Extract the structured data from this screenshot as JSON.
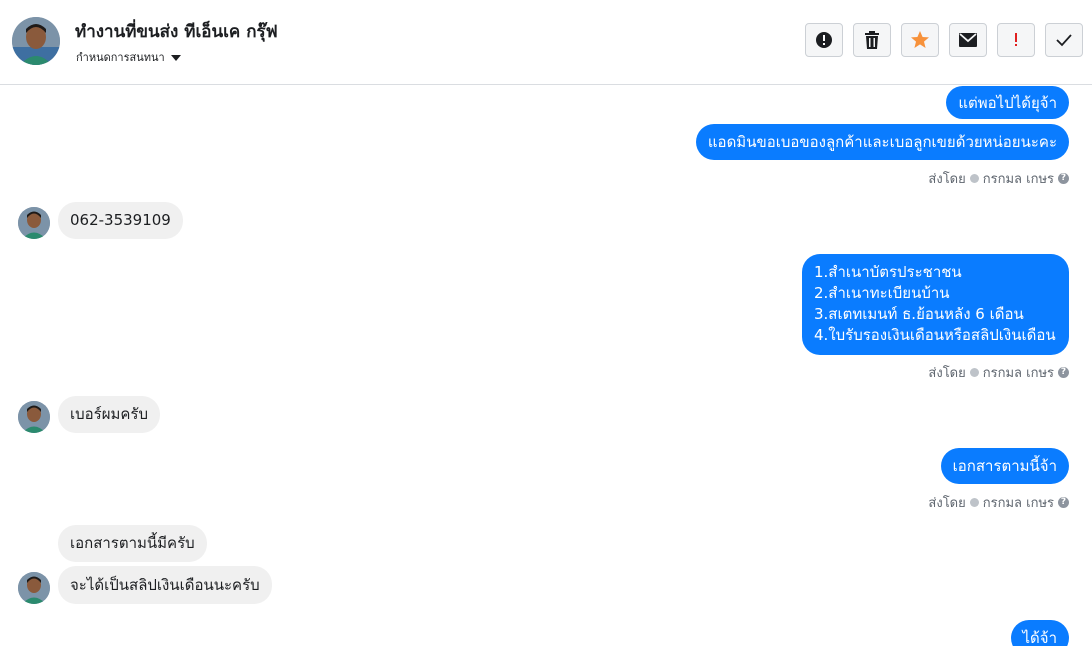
{
  "header": {
    "contact_name": "ทำงานที่ขนส่ง ทีเอ็นเค กรุ๊ฟ",
    "assign_label": "กำหนดการสนทนา",
    "actions": [
      "mark-spam",
      "delete",
      "star",
      "mark-unread",
      "follow-up",
      "done"
    ]
  },
  "colors": {
    "outgoing_bubble": "#0a7cff",
    "incoming_bubble": "#f0f0f0",
    "star": "#f7923b",
    "follow_up": "#e02020"
  },
  "messages": [
    {
      "dir": "out",
      "text": "แต่พอไปได้ยุจ้า"
    },
    {
      "dir": "out",
      "text": "แอดมินขอเบอของลูกค้าและเบอลูกเขยด้วยหน่อยนะคะ"
    },
    {
      "meta": "ส่งโดย",
      "sender": "กรกมล เกษร"
    },
    {
      "dir": "in",
      "text": "062-3539109"
    },
    {
      "dir": "out",
      "lines": [
        "1.สำเนาบัตรประชาชน",
        "2.สำเนาทะเบียนบ้าน",
        "3.สเตทเมนท์ ธ.ย้อนหลัง 6 เดือน",
        "4.ใบรับรองเงินเดือนหรือสลิปเงินเดือน"
      ]
    },
    {
      "meta": "ส่งโดย",
      "sender": "กรกมล เกษร"
    },
    {
      "dir": "in",
      "text": "เบอร์ผมครับ"
    },
    {
      "dir": "out",
      "text": "เอกสารตามนี้จ้า"
    },
    {
      "meta": "ส่งโดย",
      "sender": "กรกมล เกษร"
    },
    {
      "dir": "in",
      "text": "เอกสารตามนี้มีครับ"
    },
    {
      "dir": "in",
      "text": "จะได้เป็นสลิปเงินเดือนนะครับ"
    },
    {
      "dir": "out",
      "text": "ได้จ้า"
    }
  ]
}
